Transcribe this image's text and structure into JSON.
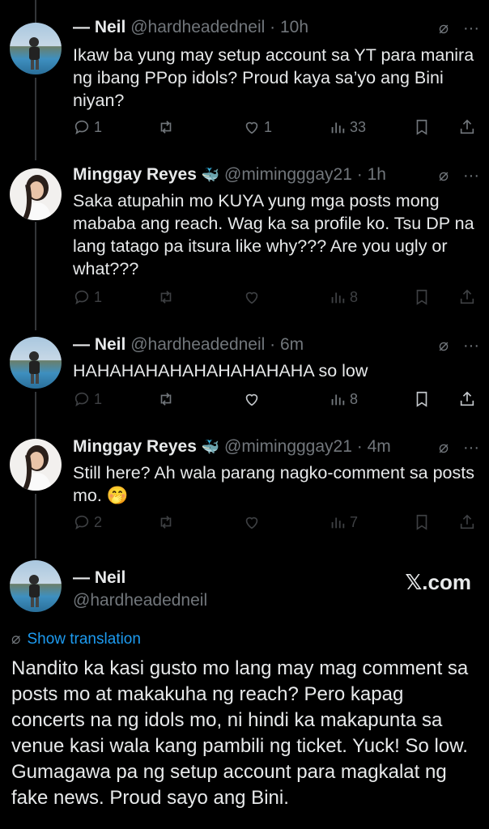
{
  "tweets": [
    {
      "name": "— Neil",
      "handle": "@hardheadedneil",
      "sep": " · ",
      "time": "10h",
      "text": "Ikaw ba yung may setup account sa YT para manira ng ibang PPop idols? Proud kaya sa’yo ang Bini niyan?",
      "replies": "1",
      "likes": "1",
      "views": "33"
    },
    {
      "name": "Minggay Reyes",
      "badge": "🐳",
      "handle": "@mimingggay21",
      "sep": " · ",
      "time": "1h",
      "text": "Saka atupahin mo KUYA yung mga posts mong mababa ang reach. Wag ka sa profile ko. Tsu DP na lang tatago pa itsura like why??? Are you ugly or what???",
      "replies": "1",
      "likes": "",
      "views": "8"
    },
    {
      "name": "— Neil",
      "handle": "@hardheadedneil",
      "sep": " · ",
      "time": "6m",
      "text": "HAHAHAHAHAHAHAHAHAHA so low",
      "replies": "1",
      "likes": "",
      "views": "8"
    },
    {
      "name": "Minggay Reyes",
      "badge": "🐳",
      "handle": "@mimingggay21",
      "sep": " · ",
      "time": "4m",
      "text": "Still here? Ah wala parang nagko-comment sa posts mo. 🤭",
      "replies": "2",
      "likes": "",
      "views": "7"
    }
  ],
  "main_post": {
    "name": "— Neil",
    "handle": "@hardheadedneil",
    "brand": "𝕏.com",
    "translate_label": "Show translation",
    "text": "Nandito ka kasi gusto mo lang may mag comment sa posts mo at makakuha ng reach? Pero kapag concerts na ng idols mo, ni hindi ka makapunta sa venue kasi wala kang pambili ng ticket. Yuck! So low. Gumagawa pa ng setup account para magkalat ng fake news. Proud sayo ang Bini."
  },
  "icons": {
    "grok": "no-translate-icon",
    "more": "more-icon",
    "reply": "reply-icon",
    "repost": "repost-icon",
    "like": "like-icon",
    "views": "views-icon",
    "bookmark": "bookmark-icon",
    "share": "share-icon"
  },
  "colors": {
    "background": "#000000",
    "text": "#e7e9ea",
    "muted": "#71767b",
    "accent": "#1d9bf0"
  }
}
